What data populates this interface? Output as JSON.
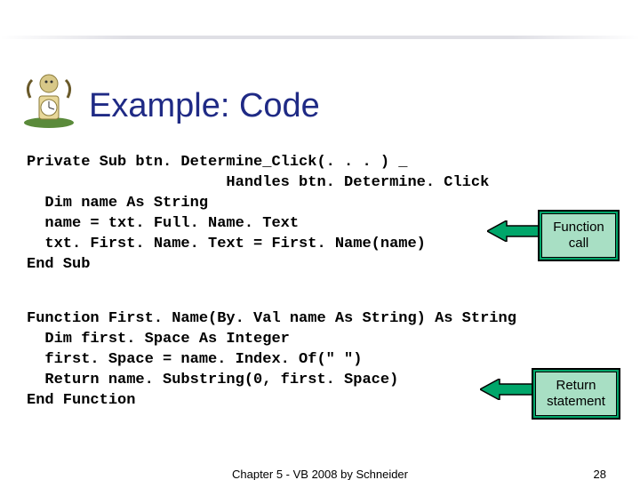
{
  "title": "Example: Code",
  "code_block_1": "Private Sub btn. Determine_Click(. . . ) _\n                      Handles btn. Determine. Click\n  Dim name As String\n  name = txt. Full. Name. Text\n  txt. First. Name. Text = First. Name(name)\nEnd Sub",
  "code_block_2": "Function First. Name(By. Val name As String) As String\n  Dim first. Space As Integer\n  first. Space = name. Index. Of(\" \")\n  Return name. Substring(0, first. Space)\nEnd Function",
  "callout1_line1": "Function",
  "callout1_line2": "call",
  "callout2_line1": "Return",
  "callout2_line2": "statement",
  "footer_center": "Chapter 5 - VB 2008 by Schneider",
  "footer_page": "28"
}
